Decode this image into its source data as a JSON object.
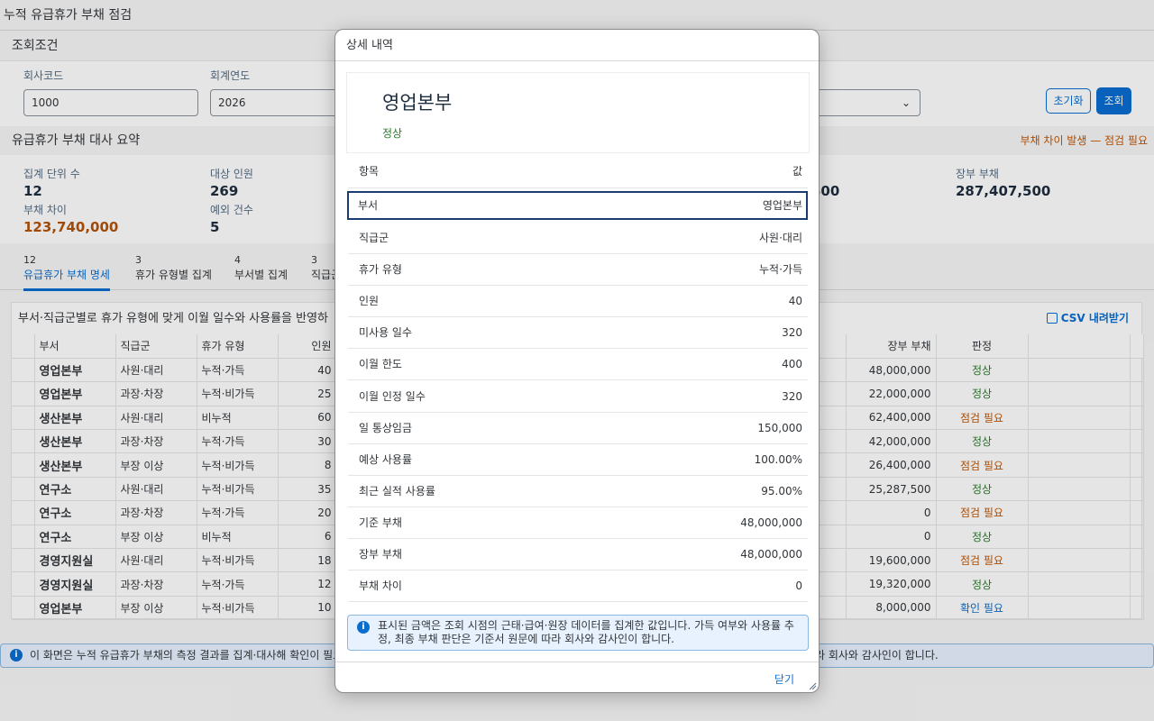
{
  "page": {
    "title": "누적 유급휴가 부채 점검"
  },
  "filter": {
    "header": "조회조건",
    "company_code_label": "회사코드",
    "company_code_value": "1000",
    "fiscal_year_label": "회계연도",
    "fiscal_year_value": "2026",
    "reset_label": "초기화",
    "search_label": "조회"
  },
  "summary": {
    "header": "유급휴가 부채 대사 요약",
    "warning": "부채 차이 발생 — 점검 필요",
    "kpis": [
      {
        "label": "집계 단위 수",
        "value": "12"
      },
      {
        "label": "대상 인원",
        "value": "269"
      },
      {
        "label": "부채 차이",
        "value": "123,740,000"
      },
      {
        "label": "예외 건수",
        "value": "5"
      },
      {
        "label": "장부 부채",
        "value": "287,407,500"
      }
    ],
    "partial_value": "500"
  },
  "tabs": [
    {
      "count": "12",
      "label": "유급휴가 부채 명세"
    },
    {
      "count": "3",
      "label": "휴가 유형별 집계"
    },
    {
      "count": "4",
      "label": "부서별 집계"
    },
    {
      "count": "3",
      "label": "직급군"
    }
  ],
  "table": {
    "title": "부서·직급군별로 휴가 유형에 맞게 이월 일수와 사용률을 반영하",
    "csv_label": "CSV 내려받기",
    "headers": {
      "dept": "부서",
      "grade": "직급군",
      "type": "휴가 유형",
      "count": "인원",
      "book": "장부 부채",
      "status": "판정"
    },
    "rows": [
      {
        "dept": "영업본부",
        "grade": "사원·대리",
        "type": "누적·가득",
        "count": "40",
        "book": "48,000,000",
        "status": "정상"
      },
      {
        "dept": "영업본부",
        "grade": "과장·차장",
        "type": "누적·비가득",
        "count": "25",
        "book": "22,000,000",
        "status": "정상"
      },
      {
        "dept": "생산본부",
        "grade": "사원·대리",
        "type": "비누적",
        "count": "60",
        "book": "62,400,000",
        "status": "점검 필요"
      },
      {
        "dept": "생산본부",
        "grade": "과장·차장",
        "type": "누적·가득",
        "count": "30",
        "book": "42,000,000",
        "status": "정상"
      },
      {
        "dept": "생산본부",
        "grade": "부장 이상",
        "type": "누적·비가득",
        "count": "8",
        "book": "26,400,000",
        "status": "점검 필요"
      },
      {
        "dept": "연구소",
        "grade": "사원·대리",
        "type": "누적·비가득",
        "count": "35",
        "book": "25,287,500",
        "status": "정상"
      },
      {
        "dept": "연구소",
        "grade": "과장·차장",
        "type": "누적·가득",
        "count": "20",
        "book": "0",
        "status": "점검 필요"
      },
      {
        "dept": "연구소",
        "grade": "부장 이상",
        "type": "비누적",
        "count": "6",
        "book": "0",
        "status": "정상"
      },
      {
        "dept": "경영지원실",
        "grade": "사원·대리",
        "type": "누적·비가득",
        "count": "18",
        "book": "19,600,000",
        "status": "점검 필요"
      },
      {
        "dept": "경영지원실",
        "grade": "과장·차장",
        "type": "누적·가득",
        "count": "12",
        "book": "19,320,000",
        "status": "정상"
      },
      {
        "dept": "영업본부",
        "grade": "부장 이상",
        "type": "누적·비가득",
        "count": "10",
        "book": "8,000,000",
        "status": "확인 필요"
      }
    ]
  },
  "info_bar": {
    "left": "이 화면은 누적 유급휴가 부채의 측정 결과를 집계·대사해 확인이 필요",
    "right": "라 회사와 감사인이 합니다."
  },
  "dialog": {
    "title": "상세 내역",
    "object_title": "영업본부",
    "object_status": "정상",
    "col_key": "항목",
    "col_value": "값",
    "rows": [
      {
        "k": "부서",
        "v": "영업본부"
      },
      {
        "k": "직급군",
        "v": "사원·대리"
      },
      {
        "k": "휴가 유형",
        "v": "누적·가득"
      },
      {
        "k": "인원",
        "v": "40"
      },
      {
        "k": "미사용 일수",
        "v": "320"
      },
      {
        "k": "이월 한도",
        "v": "400"
      },
      {
        "k": "이월 인정 일수",
        "v": "320"
      },
      {
        "k": "일 통상임금",
        "v": "150,000"
      },
      {
        "k": "예상 사용률",
        "v": "100.00%"
      },
      {
        "k": "최근 실적 사용률",
        "v": "95.00%"
      },
      {
        "k": "기준 부채",
        "v": "48,000,000"
      },
      {
        "k": "장부 부채",
        "v": "48,000,000"
      },
      {
        "k": "부채 차이",
        "v": "0"
      }
    ],
    "info": "표시된 금액은 조회 시점의 근태·급여·원장 데이터를 집계한 값입니다. 가득 여부와 사용률 추정, 최종 부채 판단은 기준서 원문에 따라 회사와 감사인이 합니다.",
    "close_label": "닫기"
  }
}
